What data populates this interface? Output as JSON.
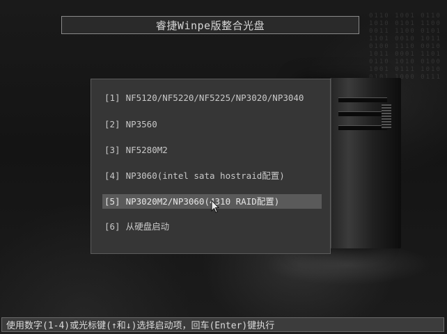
{
  "title": "睿捷Winpe版整合光盘",
  "menu": {
    "selected_index": 4,
    "items": [
      {
        "number": "[1]",
        "label": "NF5120/NF5220/NF5225/NP3020/NP3040"
      },
      {
        "number": "[2]",
        "label": "NP3560"
      },
      {
        "number": "[3]",
        "label": "NF5280M2"
      },
      {
        "number": "[4]",
        "label": "NP3060(intel sata hostraid配置)"
      },
      {
        "number": "[5]",
        "label": "NP3020M2/NP3060(4310 RAID配置)"
      },
      {
        "number": "[6]",
        "label": "从硬盘启动"
      }
    ]
  },
  "status_bar": {
    "hint": "使用数字(1-4)或光标键(↑和↓)选择启动项，回车(Enter)键执行"
  },
  "colors": {
    "background": "#151515",
    "panel": "#363636",
    "selection": "#5a5a5a",
    "text": "#c8c8c8"
  },
  "icons": {
    "cursor": "mouse-pointer-icon"
  }
}
